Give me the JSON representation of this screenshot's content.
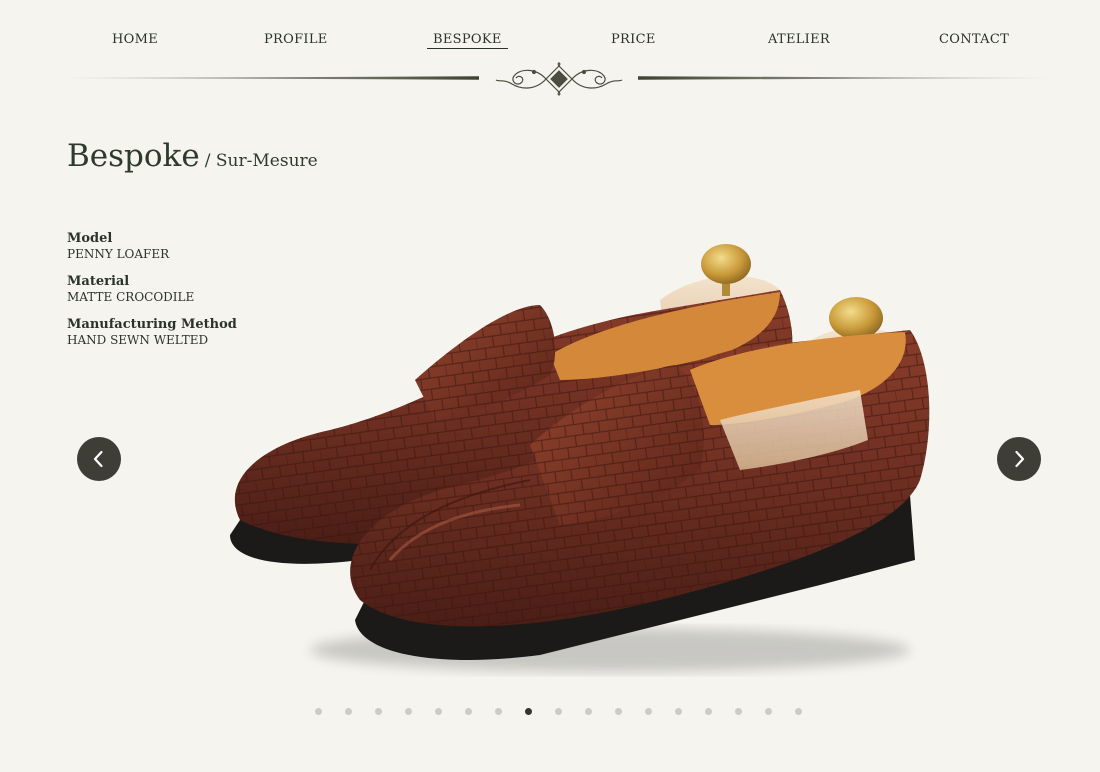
{
  "nav": {
    "items": [
      {
        "label": "HOME"
      },
      {
        "label": "PROFILE"
      },
      {
        "label": "BESPOKE"
      },
      {
        "label": "PRICE"
      },
      {
        "label": "ATELIER"
      },
      {
        "label": "CONTACT"
      }
    ],
    "active_index": 2
  },
  "page": {
    "title": "Bespoke",
    "subtitle": "/ Sur-Mesure"
  },
  "specs": [
    {
      "label": "Model",
      "value": "PENNY LOAFER"
    },
    {
      "label": "Material",
      "value": "MATTE CROCODILE"
    },
    {
      "label": "Manufacturing Method",
      "value": "HAND SEWN WELTED"
    }
  ],
  "slider": {
    "total_slides": 17,
    "active_slide": 8,
    "prev_icon": "chevron-left-icon",
    "next_icon": "chevron-right-icon"
  },
  "colors": {
    "background": "#f5f4ef",
    "text": "#2f3a2c",
    "arrow_bg": "#3f3e36",
    "shoe_leather": "#6e2f22",
    "active_dot": "#33352e",
    "inactive_dot": "#cdcbc2"
  }
}
